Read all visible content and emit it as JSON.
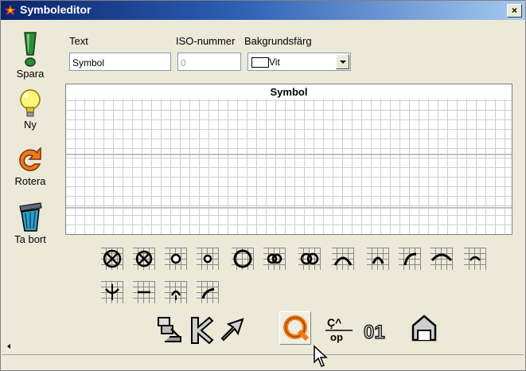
{
  "window": {
    "title": "Symboleditor",
    "close_label": "×"
  },
  "sidebar": {
    "save_label": "Spara",
    "new_label": "Ny",
    "rotate_label": "Rotera",
    "delete_label": "Ta bort"
  },
  "form": {
    "text_label": "Text",
    "text_value": "Symbol",
    "iso_label": "ISO-nummer",
    "iso_value": "0",
    "bg_label": "Bakgrundsfärg",
    "bg_value": "Vit"
  },
  "canvas": {
    "title": "Symbol"
  },
  "symbols_row1": [
    "circle-x-large",
    "circle-x",
    "circle-small",
    "circle-dot",
    "circle-large",
    "double-circle-small",
    "double-circle",
    "arc-up-wide",
    "arc-up-narrow",
    "arc-left",
    "arc-up-full",
    "arc-small"
  ],
  "symbols_row2": [
    "arc-down-cross",
    "line-bar",
    "arc-down-small",
    "arc-corner"
  ],
  "tools": [
    "text-tool",
    "line-tool",
    "arrow-tool",
    "circle-tool",
    "label-tool",
    "number-tool",
    "house-tool"
  ],
  "tool_labels": {
    "label_tool_top": "Ç^",
    "label_tool_bottom": "op",
    "number_tool": "01"
  }
}
